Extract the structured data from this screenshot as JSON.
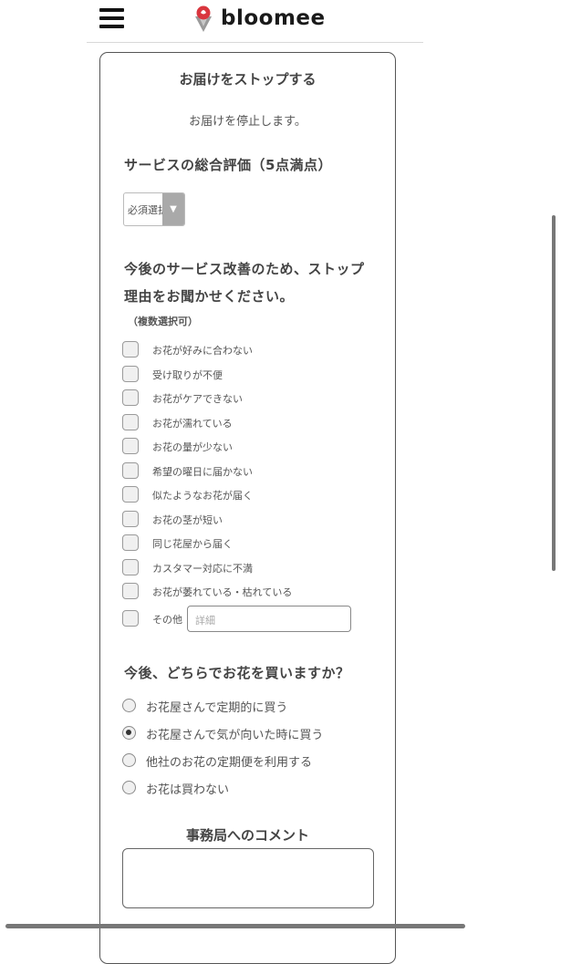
{
  "header": {
    "menu_icon": "hamburger-menu-icon",
    "logo_icon": "flower-pin-logo-icon",
    "logo_text": "bloomee",
    "logo_color": "#d9363e"
  },
  "form": {
    "title": "お届けをストップする",
    "subtitle": "お届けを停止します。",
    "rating": {
      "heading": "サービスの総合評価（5点満点）",
      "select_value": "必須選択",
      "arrow_icon": "dropdown-triangle-icon"
    },
    "reasons": {
      "heading_line1": "今後のサービス改善のため、ストップ",
      "heading_line2": "理由をお聞かせください。",
      "note": "（複数選択可）",
      "items": [
        "お花が好みに合わない",
        "受け取りが不便",
        "お花がケアできない",
        "お花が濡れている",
        "お花の量が少ない",
        "希望の曜日に届かない",
        "似たようなお花が届く",
        "お花の茎が短い",
        "同じ花屋から届く",
        "カスタマー対応に不満",
        "お花が萎れている・枯れている",
        "その他"
      ],
      "other_placeholder": "詳細"
    },
    "purchase": {
      "heading": "今後、どちらでお花を買いますか？",
      "options": [
        "お花屋さんで定期的に買う",
        "お花屋さんで気が向いた時に買う",
        "他社のお花の定期便を利用する",
        "お花は買わない"
      ],
      "selected_index": 1
    },
    "comment": {
      "heading": "事務局へのコメント",
      "value": ""
    }
  }
}
